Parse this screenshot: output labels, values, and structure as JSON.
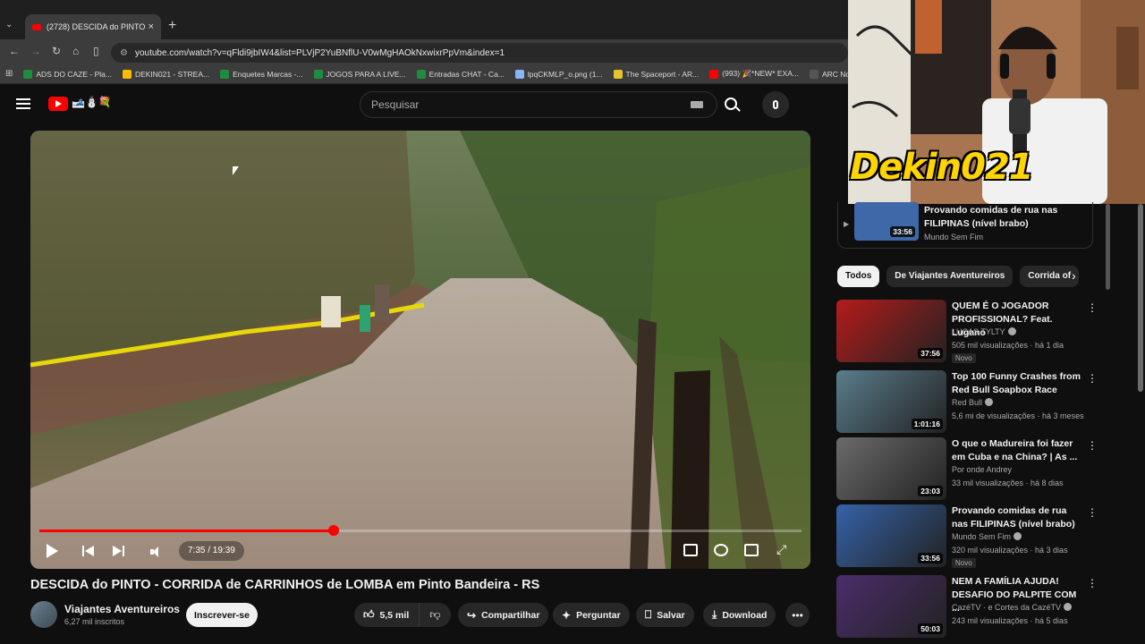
{
  "browser": {
    "tab_title": "(2728) DESCIDA do PINTO",
    "url": "youtube.com/watch?v=qFldi9jbIW4&list=PLVjP2YuBNflU-V0wMgHAOkNxwixrPpVm&index=1",
    "bookmarks": [
      {
        "label": "ADS DO CAZE - Pla...",
        "color": "#1e8e3e"
      },
      {
        "label": "DEKIN021 - STREA...",
        "color": "#fbbc04"
      },
      {
        "label": "Enquetes Marcas -...",
        "color": "#1e8e3e"
      },
      {
        "label": "JOGOS PARA A LIVE...",
        "color": "#1e8e3e"
      },
      {
        "label": "Entradas CHAT - Ca...",
        "color": "#1e8e3e"
      },
      {
        "label": "lpqCKMLP_o.png (1...",
        "color": "#8ab4f8"
      },
      {
        "label": "The Spaceport - AR...",
        "color": "#e6c32a"
      },
      {
        "label": "(993) 🎉*NEW* EXA...",
        "color": "#ff0000"
      },
      {
        "label": "ARC Now on Xb",
        "color": "#555555"
      }
    ]
  },
  "youtube": {
    "search_placeholder": "Pesquisar",
    "logo_deco": "🎿⛄💐",
    "player": {
      "time": "7:35 / 19:39",
      "progress": 0.386
    },
    "video": {
      "title": "DESCIDA do PINTO - CORRIDA de CARRINHOS de LOMBA em Pinto Bandeira - RS",
      "channel": "Viajantes Aventureiros",
      "subs": "6,27 mil inscritos",
      "subscribe": "Inscrever-se",
      "likes": "5,5 mil",
      "share": "Compartilhar",
      "ask": "Perguntar",
      "save": "Salvar",
      "download": "Download"
    }
  },
  "overlay": {
    "cam_text": "Dekin021"
  },
  "sidebar": {
    "mini": {
      "title": "Provando comidas de rua nas FILIPINAS (nível brabo)",
      "channel": "Mundo Sem Fim",
      "duration": "33:56"
    },
    "chips": [
      "Todos",
      "De Viajantes Aventureiros",
      "Corrida of"
    ],
    "recs": [
      {
        "title": "QUEM É O JOGADOR PROFISSIONAL? Feat. Lugano",
        "channel": "LUCAS TYLTY",
        "meta": "505 mil visualizações · há 1 dia",
        "badge": "Novo",
        "duration": "37:56",
        "thumb": "#b51b1b"
      },
      {
        "title": "Top 100 Funny Crashes from Red Bull Soapbox Race",
        "channel": "Red Bull",
        "meta": "5,6 mi de visualizações · há 3 meses",
        "badge": "",
        "duration": "1:01:16",
        "thumb": "#5a7d8c"
      },
      {
        "title": "O que o Madureira foi fazer em Cuba e na China? | As ...",
        "channel": "Por onde Andrey",
        "meta": "33 mil visualizações · há 8 dias",
        "badge": "",
        "duration": "23:03",
        "thumb": "#6b6b6b"
      },
      {
        "title": "Provando comidas de rua nas FILIPINAS (nível brabo)",
        "channel": "Mundo Sem Fim",
        "meta": "320 mil visualizações · há 3 dias",
        "badge": "Novo",
        "duration": "33:56",
        "thumb": "#3562a8"
      },
      {
        "title": "NEM A FAMÍLIA AJUDA! DESAFIO DO PALPITE COM ...",
        "channel": "CazéTV · e Cortes da CazéTV",
        "meta": "243 mil visualizações · há 5 dias",
        "badge": "",
        "duration": "50:03",
        "thumb": "#4b2d6b"
      }
    ]
  }
}
